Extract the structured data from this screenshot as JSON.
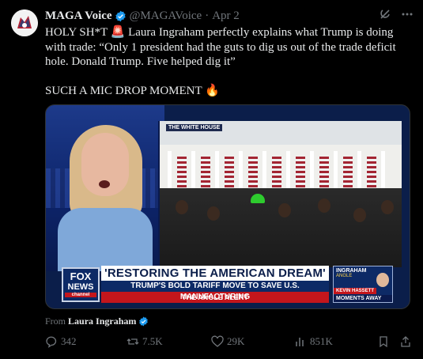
{
  "tweet": {
    "author_name": "MAGA Voice",
    "handle": "@MAGAVoice",
    "separator": "·",
    "date": "Apr 2",
    "text_line1": "HOLY SH*T 🚨 Laura Ingraham perfectly explains what Trump is doing with trade: “Only 1 president had the guts to dig us out of the trade deficit hole. Donald Trump. Five helped dig it”",
    "text_line2": "SUCH A MIC DROP MOMENT 🔥"
  },
  "media": {
    "wh_label": "THE WHITE HOUSE",
    "fox_line1": "FOX",
    "fox_line2": "NEWS",
    "fox_line3": "channel",
    "banner_headline": "'RESTORING THE AMERICAN DREAM'",
    "banner_sub": "TRUMP'S BOLD TARIFF MOVE TO SAVE U.S. MANUFACTURING",
    "banner_tag": "THE ANGLE ALERT",
    "side_title": "INGRAHAM",
    "side_sub": "ANGLE",
    "side_guest": "KEVIN HASSETT",
    "side_footer": "MOMENTS AWAY"
  },
  "source": {
    "prefix": "From",
    "name": "Laura Ingraham"
  },
  "actions": {
    "replies": "342",
    "reposts": "7.5K",
    "likes": "29K",
    "views": "851K"
  },
  "colors": {
    "verified": "#1d9bf0",
    "muted": "#71767b",
    "fox_red": "#c4161c",
    "fox_navy": "#0d2a66"
  },
  "icons": [
    "grok-icon",
    "more-icon",
    "verified-badge-icon",
    "reply-icon",
    "repost-icon",
    "like-icon",
    "views-icon",
    "bookmark-icon",
    "share-icon"
  ]
}
